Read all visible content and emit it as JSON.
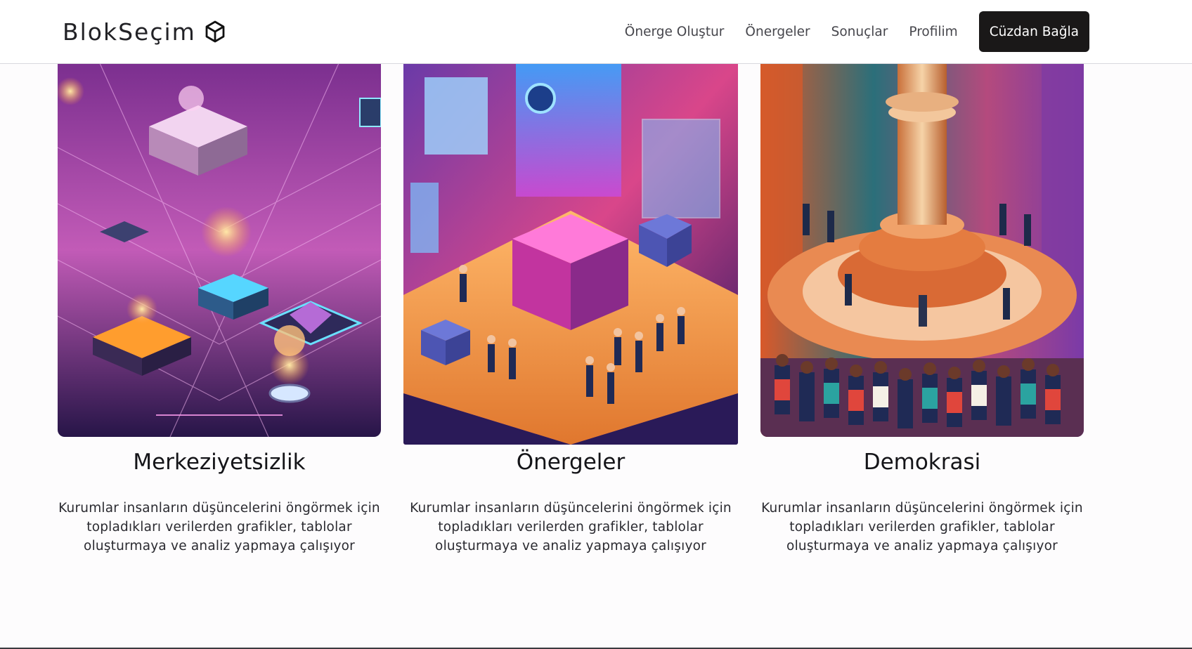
{
  "header": {
    "brand": "BlokSeçim",
    "brand_icon": "cube-icon",
    "nav": [
      {
        "label": "Önerge Oluştur"
      },
      {
        "label": "Önergeler"
      },
      {
        "label": "Sonuçlar"
      },
      {
        "label": "Profilim"
      }
    ],
    "wallet_button": "Cüzdan Bağla"
  },
  "cards": [
    {
      "title": "Merkeziyetsizlik",
      "text": "Kurumlar insanların düşüncelerini öngörmek için topladıkları verilerden grafikler, tablolar oluşturmaya ve analiz yapmaya çalışıyor",
      "image": "isometric-digital-city-illustration"
    },
    {
      "title": "Önergeler",
      "text": "Kurumlar insanların düşüncelerini öngörmek için topladıkları verilerden grafikler, tablolar oluşturmaya ve analiz yapmaya çalışıyor",
      "image": "isometric-voting-kiosk-illustration"
    },
    {
      "title": "Demokrasi",
      "text": "Kurumlar insanların düşüncelerini öngörmek için topladıkları verilerden grafikler, tablolar oluşturmaya ve analiz yapmaya çalışıyor",
      "image": "crowd-around-column-illustration"
    }
  ],
  "colors": {
    "button_bg": "#1a1818",
    "nav_text": "#46464c",
    "page_bg": "#fdfcfd"
  }
}
